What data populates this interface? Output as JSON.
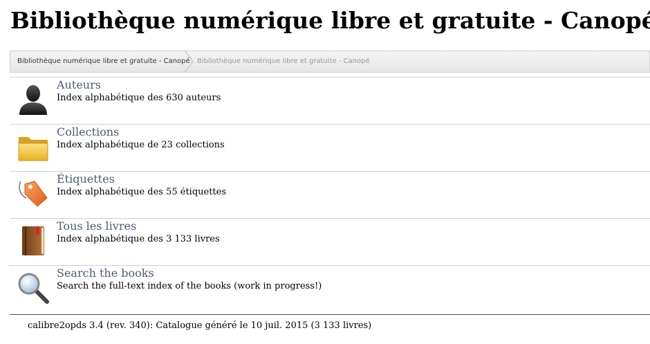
{
  "header": {
    "title": "Bibliothèque numérique libre et gratuite - Canopé"
  },
  "breadcrumb": {
    "items": [
      "Bibliothèque numérique libre et gratuite - Canopé",
      "Bibliothèque numérique libre et gratuite - Canopé"
    ]
  },
  "menu": {
    "items": [
      {
        "label": "Auteurs",
        "desc": "Index alphabétique des 630 auteurs",
        "icon": "author-icon"
      },
      {
        "label": "Collections",
        "desc": "Index alphabétique de 23 collections",
        "icon": "folder-icon"
      },
      {
        "label": "Étiquettes",
        "desc": "Index alphabétique des 55 étiquettes",
        "icon": "tag-icon"
      },
      {
        "label": "Tous les livres",
        "desc": "Index alphabétique des 3 133 livres",
        "icon": "book-icon"
      },
      {
        "label": "Search the books",
        "desc": "Search the full-text index of the books (work in progress!)",
        "icon": "search-icon"
      }
    ]
  },
  "footer": {
    "text": "calibre2opds 3.4 (rev. 340): Catalogue généré le 10 juil. 2015 (3 133 livres)"
  },
  "colors": {
    "link": "#4a5a7a",
    "tag": "#f07a2a",
    "folder": "#f2c94c",
    "book": "#9a5a2a"
  }
}
